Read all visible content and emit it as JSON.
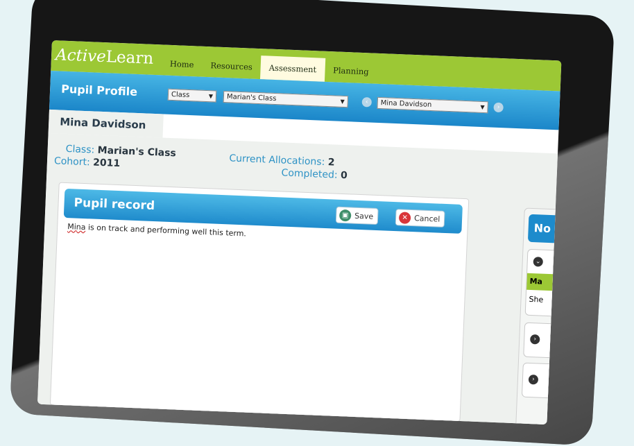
{
  "nav": {
    "logo_part1": "Active",
    "logo_part2": "Learn",
    "items": [
      "Home",
      "Resources",
      "Assessment",
      "Planning"
    ],
    "active": "Assessment"
  },
  "profile_bar": {
    "title": "Pupil Profile",
    "filter_type": "Class",
    "class_value": "Marian's Class",
    "pupil_value": "Mina Davidson"
  },
  "pupil": {
    "name": "Mina Davidson",
    "class_label": "Class:",
    "class_value": "Marian's Class",
    "cohort_label": "Cohort:",
    "cohort_value": "2011",
    "allocations_label": "Current Allocations:",
    "allocations_value": "2",
    "completed_label": "Completed:",
    "completed_value": "0"
  },
  "record": {
    "title": "Pupil record",
    "save_label": "Save",
    "cancel_label": "Cancel",
    "text_first": "Mina",
    "text_rest": " is on track and performing well this term."
  },
  "side": {
    "title": "No",
    "row1": "Ma",
    "row2": "She"
  },
  "colors": {
    "nav_green": "#9cc835",
    "header_blue": "#1b86c9",
    "label_blue": "#2d92c5"
  },
  "icons": [
    "save-icon",
    "cancel-icon",
    "chevron-left-icon",
    "chevron-right-icon",
    "chevron-down-icon"
  ]
}
